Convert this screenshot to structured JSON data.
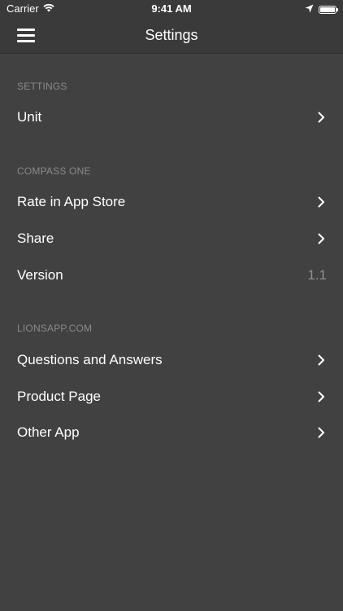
{
  "status_bar": {
    "carrier": "Carrier",
    "time": "9:41 AM",
    "battery_level": 1.0,
    "icons": [
      "wifi-icon",
      "location-arrow-icon",
      "battery-icon"
    ]
  },
  "nav": {
    "title": "Settings",
    "menu_icon": "hamburger-menu-icon"
  },
  "sections": [
    {
      "header": "SETTINGS",
      "items": [
        {
          "label": "Unit",
          "accessory": "chevron-right-icon"
        }
      ]
    },
    {
      "header": "COMPASS ONE",
      "items": [
        {
          "label": "Rate in App Store",
          "accessory": "chevron-right-icon"
        },
        {
          "label": "Share",
          "accessory": "chevron-right-icon"
        },
        {
          "label": "Version",
          "value": "1.1"
        }
      ]
    },
    {
      "header": "LIONSAPP.COM",
      "items": [
        {
          "label": "Questions and Answers",
          "accessory": "chevron-right-icon"
        },
        {
          "label": "Product Page",
          "accessory": "chevron-right-icon"
        },
        {
          "label": "Other App",
          "accessory": "chevron-right-icon"
        }
      ]
    }
  ],
  "colors": {
    "background": "#414141",
    "bar_background": "#3a3a3a",
    "section_header": "#8a8a8a",
    "text": "#ffffff",
    "secondary_value": "#8f8f8f"
  }
}
